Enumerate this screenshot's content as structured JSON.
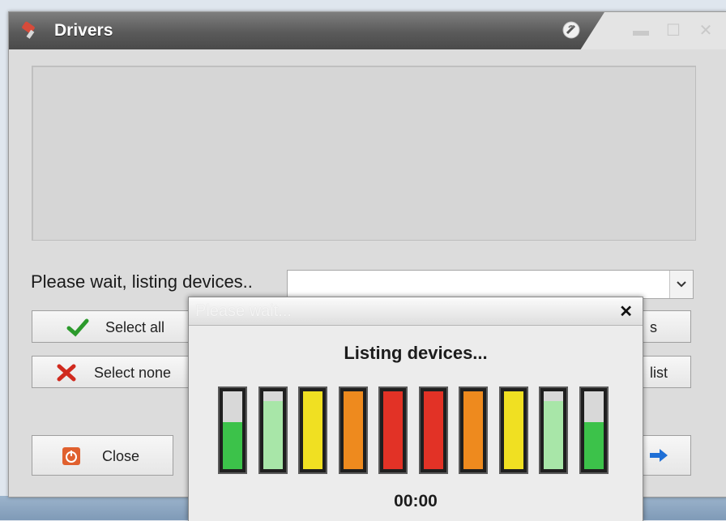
{
  "window": {
    "title": "Drivers",
    "status_label": "Please wait, listing devices..",
    "combo_value": "",
    "buttons": {
      "select_all": "Select all",
      "select_none": "Select none",
      "close": "Close",
      "right_top_partial": "s",
      "right_mid_partial": "list"
    }
  },
  "dialog": {
    "title": "Please wait...",
    "message": "Listing devices...",
    "timer": "00:00",
    "bars": [
      {
        "level": 0.6,
        "color": "#3cc24a"
      },
      {
        "level": 0.87,
        "color": "#a8e6a8"
      },
      {
        "level": 1.0,
        "color": "#f0e022"
      },
      {
        "level": 1.0,
        "color": "#ee8a1e"
      },
      {
        "level": 1.0,
        "color": "#e23226"
      },
      {
        "level": 1.0,
        "color": "#e23226"
      },
      {
        "level": 1.0,
        "color": "#ee8a1e"
      },
      {
        "level": 1.0,
        "color": "#f0e022"
      },
      {
        "level": 0.87,
        "color": "#a8e6a8"
      },
      {
        "level": 0.6,
        "color": "#3cc24a"
      }
    ]
  },
  "icons": [
    "app-icon",
    "help-icon",
    "minimize-icon",
    "maximize-icon",
    "close-icon",
    "dropdown-icon",
    "checkmark-icon",
    "red-x-icon",
    "power-icon",
    "arrow-right-icon",
    "dialog-close-icon"
  ]
}
